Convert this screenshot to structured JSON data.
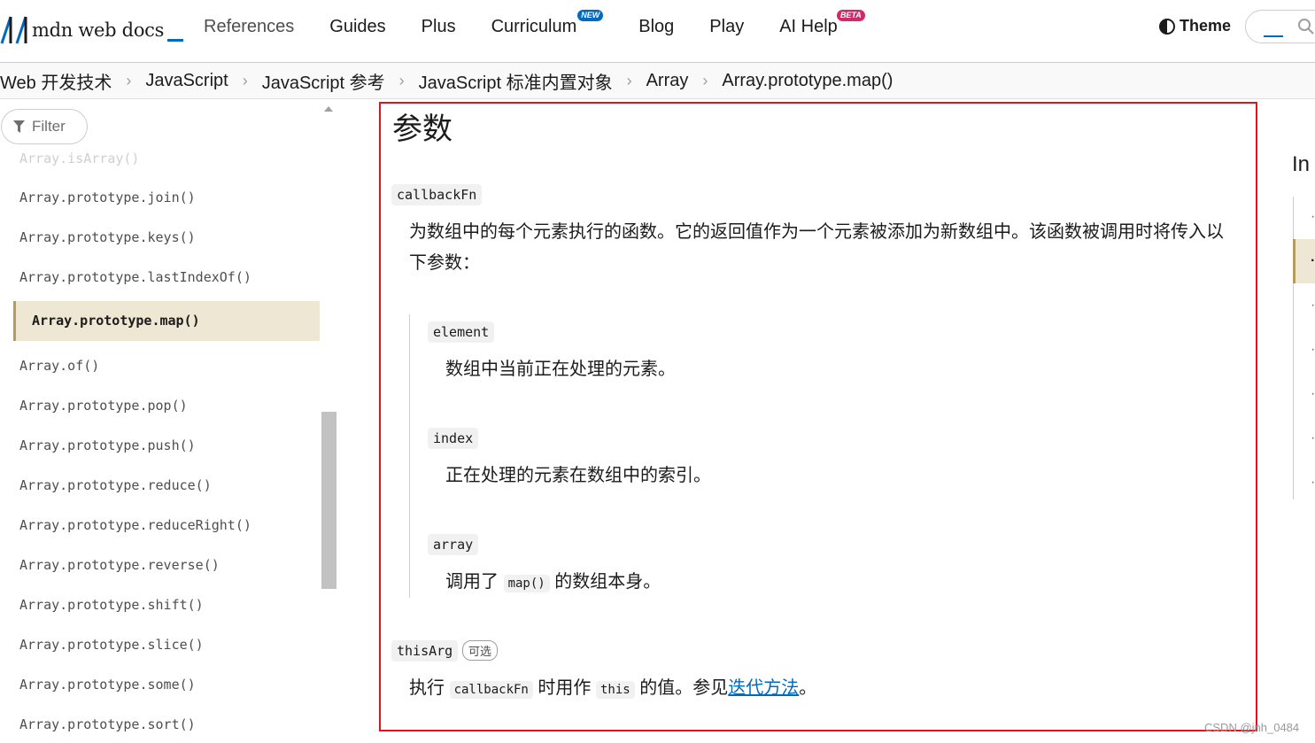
{
  "header": {
    "logo_text": "mdn web docs",
    "nav": [
      {
        "label": "References"
      },
      {
        "label": "Guides"
      },
      {
        "label": "Plus"
      },
      {
        "label": "Curriculum",
        "badge": "NEW"
      },
      {
        "label": "Blog"
      },
      {
        "label": "Play"
      },
      {
        "label": "AI Help",
        "badge": "BETA"
      }
    ],
    "theme_label": "Theme"
  },
  "breadcrumb": [
    "Web 开发技术",
    "JavaScript",
    "JavaScript 参考",
    "JavaScript 标准内置对象",
    "Array",
    "Array.prototype.map()"
  ],
  "sidebar": {
    "filter_label": "Filter",
    "partial_item": "Array.isArray()",
    "items": [
      "Array.prototype.join()",
      "Array.prototype.keys()",
      "Array.prototype.lastIndexOf()",
      "Array.prototype.map()",
      "Array.of()",
      "Array.prototype.pop()",
      "Array.prototype.push()",
      "Array.prototype.reduce()",
      "Array.prototype.reduceRight()",
      "Array.prototype.reverse()",
      "Array.prototype.shift()",
      "Array.prototype.slice()",
      "Array.prototype.some()",
      "Array.prototype.sort()"
    ],
    "active_item": "Array.prototype.map()"
  },
  "content": {
    "heading": "参数",
    "callback": {
      "name": "callbackFn",
      "desc_line1": "为数组中的每个元素执行的函数。它的返回值作为一个元素被添加为新数组中。该函数被调用时将传入以",
      "desc_line2": "下参数："
    },
    "params": [
      {
        "name": "element",
        "desc": "数组中当前正在处理的元素。"
      },
      {
        "name": "index",
        "desc": "正在处理的元素在数组中的索引。"
      },
      {
        "name": "array",
        "desc_before": "调用了",
        "code": "map()",
        "desc_after": "的数组本身。"
      }
    ],
    "this_arg": {
      "name": "thisArg",
      "badge": "可选",
      "desc_before": "执行",
      "code1": "callbackFn",
      "desc_mid": "时用作",
      "code2": "this",
      "desc_after_code": "的值。参见",
      "link": "迭代方法",
      "desc_end": "。"
    }
  },
  "toc": {
    "title": "In"
  },
  "watermark": "CSDN @jnh_0484",
  "colors": {
    "accent": "#0069c2",
    "highlight_bg": "#ede7d3",
    "highlight_border": "#b39d5e",
    "frame": "#e4121b"
  }
}
